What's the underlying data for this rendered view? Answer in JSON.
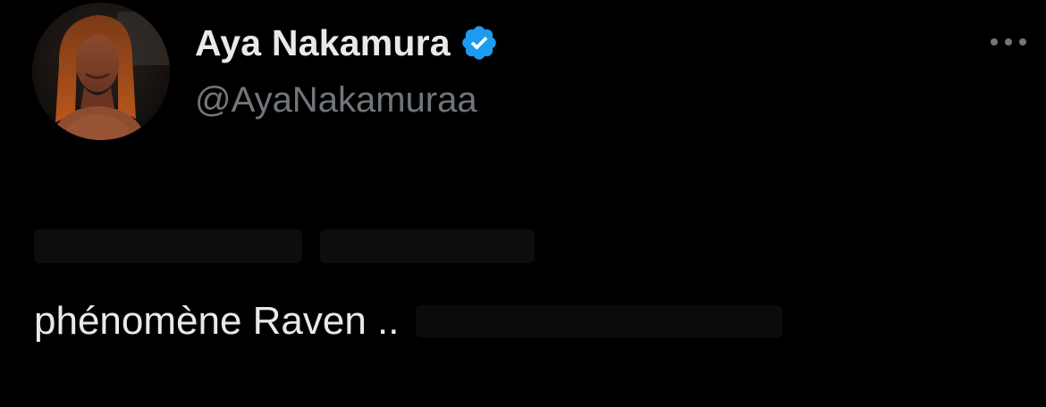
{
  "tweet": {
    "author": {
      "display_name": "Aya Nakamura",
      "handle": "@AyaNakamuraa",
      "verified": true,
      "verified_color": "#1d9bf0"
    },
    "body": {
      "visible_text": "phénomène Raven .."
    }
  },
  "icons": {
    "avatar": "avatar",
    "verified": "verified-badge-icon",
    "more": "more-options-icon"
  }
}
